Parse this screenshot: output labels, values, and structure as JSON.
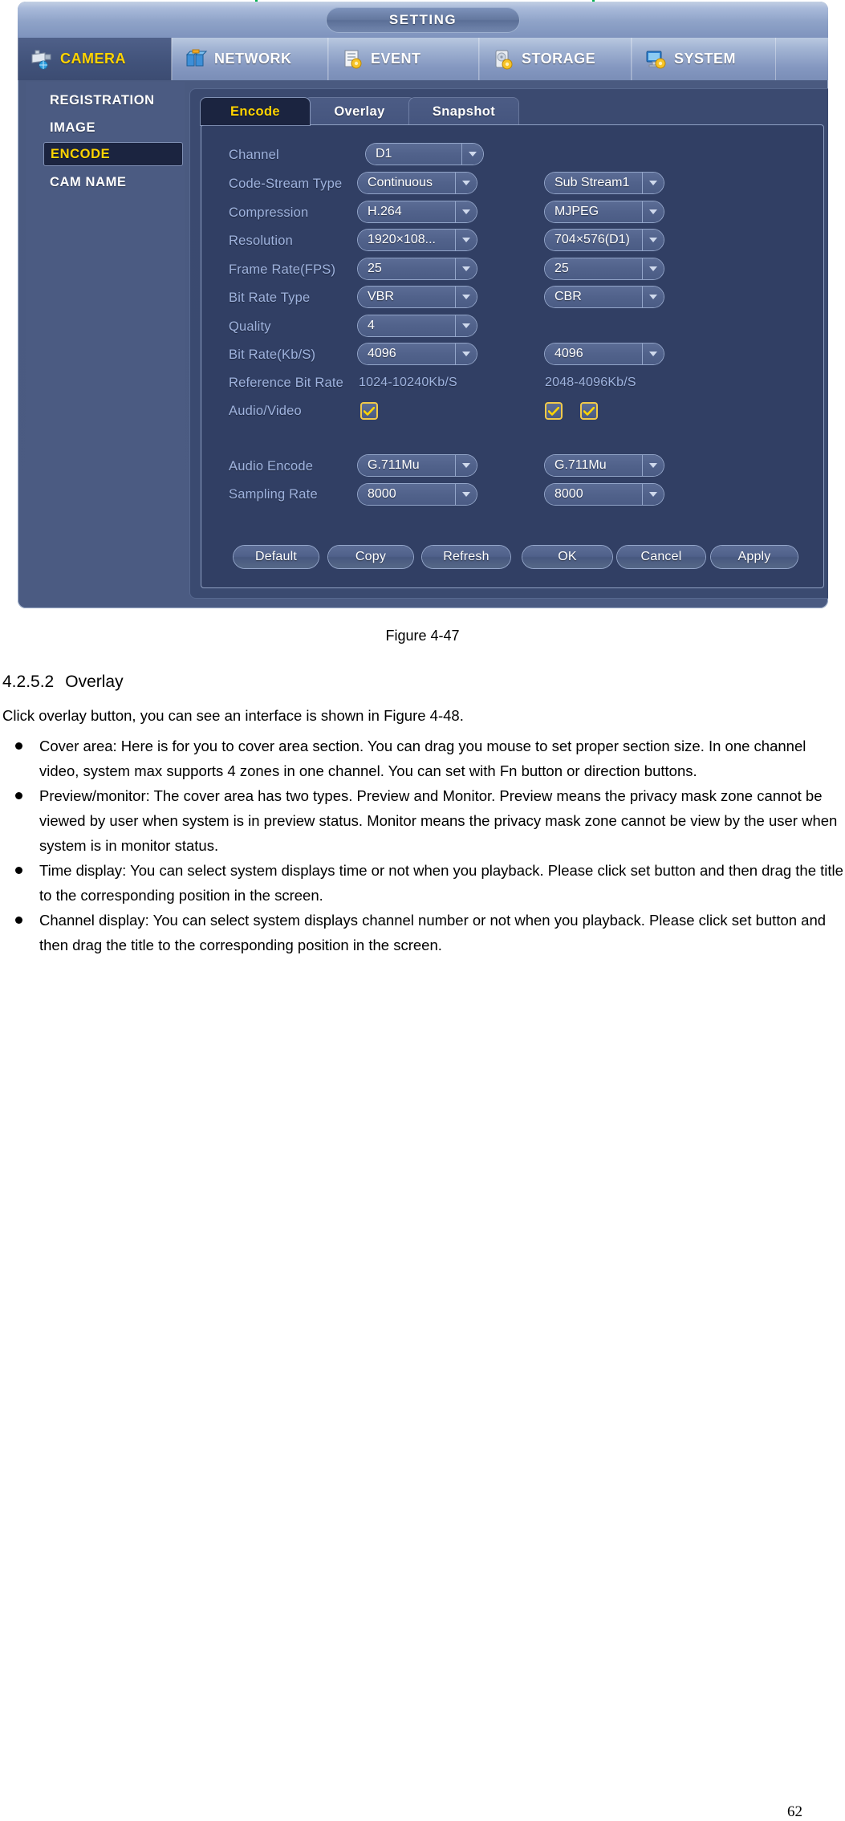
{
  "dvr": {
    "window_title": "SETTING",
    "menu": [
      {
        "label": "CAMERA",
        "icon": "camera-icon",
        "active": true
      },
      {
        "label": "NETWORK",
        "icon": "network-icon",
        "active": false
      },
      {
        "label": "EVENT",
        "icon": "event-icon",
        "active": false
      },
      {
        "label": "STORAGE",
        "icon": "storage-icon",
        "active": false
      },
      {
        "label": "SYSTEM",
        "icon": "system-icon",
        "active": false
      }
    ],
    "sidebar": [
      {
        "label": "REGISTRATION",
        "active": false
      },
      {
        "label": "IMAGE",
        "active": false
      },
      {
        "label": "ENCODE",
        "active": true
      },
      {
        "label": "CAM NAME",
        "active": false
      }
    ],
    "tabs": [
      {
        "label": "Encode",
        "active": true
      },
      {
        "label": "Overlay",
        "active": false
      },
      {
        "label": "Snapshot",
        "active": false
      }
    ],
    "form": {
      "labels": {
        "channel": "Channel",
        "code_stream_type": "Code-Stream Type",
        "compression": "Compression",
        "resolution": "Resolution",
        "frame_rate": "Frame Rate(FPS)",
        "bit_rate_type": "Bit Rate Type",
        "quality": "Quality",
        "bit_rate": "Bit Rate(Kb/S)",
        "reference_bit_rate": "Reference Bit Rate",
        "audio_video": "Audio/Video",
        "audio_encode": "Audio Encode",
        "sampling_rate": "Sampling Rate"
      },
      "main_stream": {
        "channel": "D1",
        "code_stream_type": "Continuous",
        "compression": "H.264",
        "resolution": "1920×108...",
        "frame_rate": "25",
        "bit_rate_type": "VBR",
        "quality": "4",
        "bit_rate": "4096",
        "reference_bit_rate": "1024-10240Kb/S",
        "audio_video_checked": true,
        "audio_encode": "G.711Mu",
        "sampling_rate": "8000"
      },
      "sub_stream": {
        "code_stream_type": "Sub Stream1",
        "compression": "MJPEG",
        "resolution": "704×576(D1)",
        "frame_rate": "25",
        "bit_rate_type": "CBR",
        "bit_rate": "4096",
        "reference_bit_rate": "2048-4096Kb/S",
        "audio_checked": true,
        "video_checked": true,
        "audio_encode": "G.711Mu",
        "sampling_rate": "8000"
      }
    },
    "buttons": [
      {
        "label": "Default"
      },
      {
        "label": "Copy"
      },
      {
        "label": "Refresh"
      },
      {
        "label": "OK"
      },
      {
        "label": "Cancel"
      },
      {
        "label": "Apply"
      }
    ]
  },
  "document": {
    "figure_caption": "Figure 4-47",
    "section_number": "4.2.5.2",
    "section_title": "Overlay",
    "intro": "Click overlay button, you can see an interface is shown in Figure 4-48.",
    "bullets": [
      "Cover area: Here is for you to cover area section. You can drag you mouse to set proper section size. In one channel video, system max supports 4 zones in one channel. You can set with Fn button or direction buttons.",
      "Preview/monitor: The cover area has two types. Preview and Monitor. Preview means the privacy mask zone cannot be viewed by user when system is in preview status. Monitor means the privacy mask zone cannot be view by the user when system is in monitor status.",
      "Time display: You can select system displays time or not when you playback. Please click set button and then drag the title to the corresponding position in the screen.",
      "Channel display: You can select system displays channel number or not when you playback. Please click set button and then drag the title to the corresponding position in the screen."
    ],
    "page_number": "62"
  },
  "colors": {
    "accent_yellow": "#ffd400",
    "panel_blue": "#4b5b82",
    "content_blue": "#3b4a70",
    "inner_blue": "#313f64",
    "label_blue": "#9fb3de",
    "active_dark": "#1b2440"
  }
}
